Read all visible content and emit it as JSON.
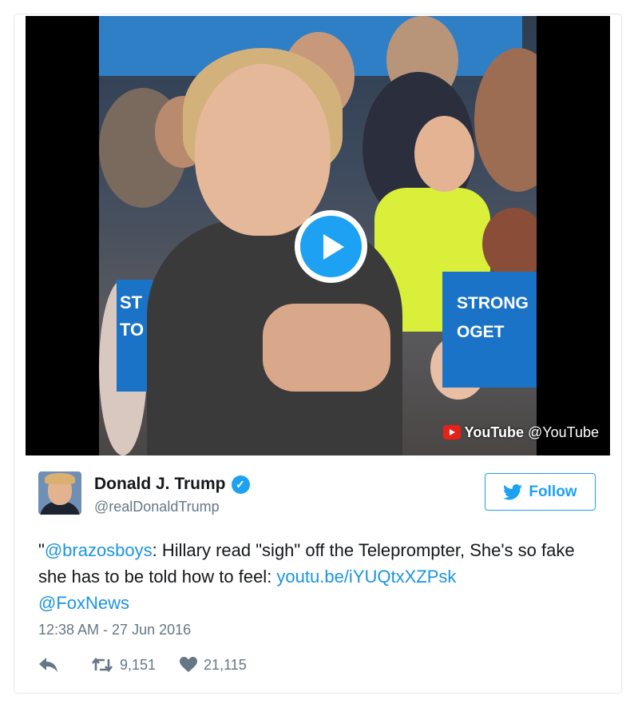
{
  "media": {
    "youtube_badge": {
      "icon": "youtube-logo-icon",
      "name": "YouTube",
      "handle": "@YouTube"
    },
    "play_icon": "play-icon",
    "signs": [
      "ST",
      "TO",
      "STRONG",
      "OGET"
    ]
  },
  "tweet": {
    "author_name": "Donald J. Trump",
    "author_handle": "@realDonaldTrump",
    "verified_icon": "verified-badge-icon",
    "text": {
      "open_quote": "\"",
      "mention_1": "@brazosboys",
      "body": ": Hillary read \"sigh\" off the Teleprompter, She's so fake she has to be told how to feel: ",
      "link": "youtu.be/iYUQtxXZPsk",
      "mention_2": "@FoxNews"
    },
    "timestamp": "12:38 AM - 27 Jun 2016",
    "follow_label": "Follow",
    "retweet_count": "9,151",
    "like_count": "21,115"
  },
  "colors": {
    "accent": "#1da1f2",
    "link": "#1b95e0",
    "muted": "#657786",
    "youtube_red": "#e62117"
  }
}
